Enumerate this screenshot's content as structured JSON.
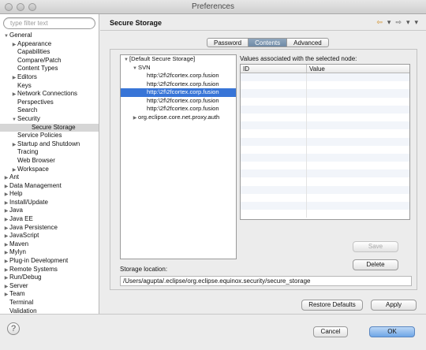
{
  "window": {
    "title": "Preferences"
  },
  "sidebar": {
    "filter_placeholder": "type filter text",
    "items": [
      {
        "label": "General",
        "indent": 0,
        "arrow": "▼"
      },
      {
        "label": "Appearance",
        "indent": 1,
        "arrow": "▶"
      },
      {
        "label": "Capabilities",
        "indent": 1,
        "arrow": ""
      },
      {
        "label": "Compare/Patch",
        "indent": 1,
        "arrow": ""
      },
      {
        "label": "Content Types",
        "indent": 1,
        "arrow": ""
      },
      {
        "label": "Editors",
        "indent": 1,
        "arrow": "▶"
      },
      {
        "label": "Keys",
        "indent": 1,
        "arrow": ""
      },
      {
        "label": "Network Connections",
        "indent": 1,
        "arrow": "▶"
      },
      {
        "label": "Perspectives",
        "indent": 1,
        "arrow": ""
      },
      {
        "label": "Search",
        "indent": 1,
        "arrow": ""
      },
      {
        "label": "Security",
        "indent": 1,
        "arrow": "▼"
      },
      {
        "label": "Secure Storage",
        "indent": 2,
        "arrow": "",
        "selected": true
      },
      {
        "label": "Service Policies",
        "indent": 1,
        "arrow": ""
      },
      {
        "label": "Startup and Shutdown",
        "indent": 1,
        "arrow": "▶"
      },
      {
        "label": "Tracing",
        "indent": 1,
        "arrow": ""
      },
      {
        "label": "Web Browser",
        "indent": 1,
        "arrow": ""
      },
      {
        "label": "Workspace",
        "indent": 1,
        "arrow": "▶"
      },
      {
        "label": "Ant",
        "indent": 0,
        "arrow": "▶"
      },
      {
        "label": "Data Management",
        "indent": 0,
        "arrow": "▶"
      },
      {
        "label": "Help",
        "indent": 0,
        "arrow": "▶"
      },
      {
        "label": "Install/Update",
        "indent": 0,
        "arrow": "▶"
      },
      {
        "label": "Java",
        "indent": 0,
        "arrow": "▶"
      },
      {
        "label": "Java EE",
        "indent": 0,
        "arrow": "▶"
      },
      {
        "label": "Java Persistence",
        "indent": 0,
        "arrow": "▶"
      },
      {
        "label": "JavaScript",
        "indent": 0,
        "arrow": "▶"
      },
      {
        "label": "Maven",
        "indent": 0,
        "arrow": "▶"
      },
      {
        "label": "Mylyn",
        "indent": 0,
        "arrow": "▶"
      },
      {
        "label": "Plug-in Development",
        "indent": 0,
        "arrow": "▶"
      },
      {
        "label": "Remote Systems",
        "indent": 0,
        "arrow": "▶"
      },
      {
        "label": "Run/Debug",
        "indent": 0,
        "arrow": "▶"
      },
      {
        "label": "Server",
        "indent": 0,
        "arrow": "▶"
      },
      {
        "label": "Team",
        "indent": 0,
        "arrow": "▶"
      },
      {
        "label": "Terminal",
        "indent": 0,
        "arrow": ""
      },
      {
        "label": "Validation",
        "indent": 0,
        "arrow": ""
      }
    ]
  },
  "main": {
    "title": "Secure Storage",
    "nav": {
      "back": "⇦",
      "back_menu": "▾",
      "forward": "⇨",
      "forward_menu": "▾",
      "menu": "▾"
    },
    "tabs": [
      {
        "label": "Password",
        "active": false
      },
      {
        "label": "Contents",
        "active": true
      },
      {
        "label": "Advanced",
        "active": false
      }
    ],
    "node_tree": [
      {
        "label": "[Default Secure Storage]",
        "indent": 0,
        "arrow": "▼"
      },
      {
        "label": "SVN",
        "indent": 1,
        "arrow": "▼"
      },
      {
        "label": "http:\\2f\\2fcortex.corp.fusion",
        "indent": 2,
        "arrow": ""
      },
      {
        "label": "http:\\2f\\2fcortex.corp.fusion",
        "indent": 2,
        "arrow": ""
      },
      {
        "label": "http:\\2f\\2fcortex.corp.fusion",
        "indent": 2,
        "arrow": "",
        "selected": true
      },
      {
        "label": "http:\\2f\\2fcortex.corp.fusion",
        "indent": 2,
        "arrow": ""
      },
      {
        "label": "http:\\2f\\2fcortex.corp.fusion",
        "indent": 2,
        "arrow": ""
      },
      {
        "label": "org.eclipse.core.net.proxy.auth",
        "indent": 1,
        "arrow": "▶"
      }
    ],
    "values_label": "Values associated with the selected node:",
    "columns": [
      "ID",
      "Value"
    ],
    "save_label": "Save",
    "delete_label": "Delete",
    "location_label": "Storage location:",
    "location_value": "/Users/agupta/.eclipse/org.eclipse.equinox.security/secure_storage",
    "restore_defaults_label": "Restore Defaults",
    "apply_label": "Apply"
  },
  "footer": {
    "help_label": "?",
    "cancel_label": "Cancel",
    "ok_label": "OK"
  }
}
